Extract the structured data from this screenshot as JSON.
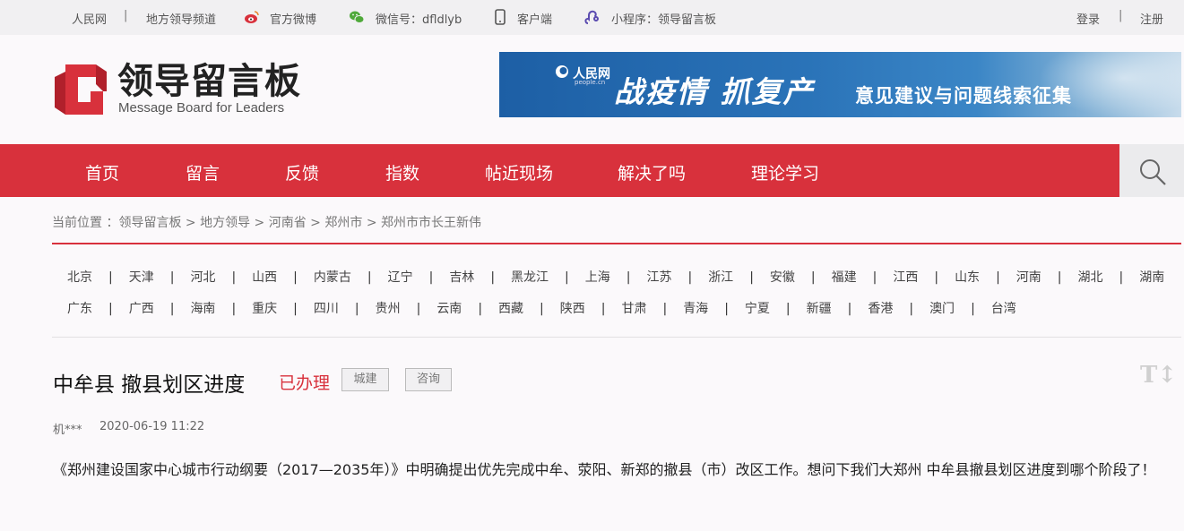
{
  "topbar": {
    "site": "人民网",
    "sep": "|",
    "channel": "地方领导频道",
    "weibo": "官方微博",
    "wechat": "微信号：dfldlyb",
    "client": "客户端",
    "miniprogram": "小程序：领导留言板",
    "login": "登录",
    "register": "注册"
  },
  "header": {
    "logo_cn": "领导留言板",
    "logo_en": "Message Board for Leaders",
    "brand_color": "#d8313c"
  },
  "banner": {
    "pd_logo": "人民网",
    "pd_domain": "people.cn",
    "headline": "战疫情 抓复产",
    "subline": "意见建议与问题线索征集"
  },
  "nav": {
    "items": [
      "首页",
      "留言",
      "反馈",
      "指数",
      "帖近现场",
      "解决了吗",
      "理论学习"
    ]
  },
  "breadcrumb": {
    "prefix": "当前位置 ：",
    "items": [
      "领导留言板",
      "地方领导",
      "河南省",
      "郑州市",
      "郑州市市长王新伟"
    ],
    "separator": " > "
  },
  "provinces": {
    "row1": [
      "北京",
      "天津",
      "河北",
      "山西",
      "内蒙古",
      "辽宁",
      "吉林",
      "黑龙江",
      "上海",
      "江苏",
      "浙江",
      "安徽",
      "福建",
      "江西",
      "山东",
      "河南",
      "湖北",
      "湖南"
    ],
    "row2": [
      "广东",
      "广西",
      "海南",
      "重庆",
      "四川",
      "贵州",
      "云南",
      "西藏",
      "陕西",
      "甘肃",
      "青海",
      "宁夏",
      "新疆",
      "香港",
      "澳门",
      "台湾"
    ],
    "separator": "|"
  },
  "post": {
    "title": "中牟县 撤县划区进度",
    "status": "已办理",
    "tags": [
      "城建",
      "咨询"
    ],
    "author": "机***",
    "datetime": "2020-06-19 11:22",
    "content": "《郑州建设国家中心城市行动纲要（2017—2035年）》中明确提出优先完成中牟、荥阳、新郑的撤县（市）改区工作。想问下我们大郑州 中牟县撤县划区进度到哪个阶段了！",
    "font_toggle": "T↕"
  }
}
